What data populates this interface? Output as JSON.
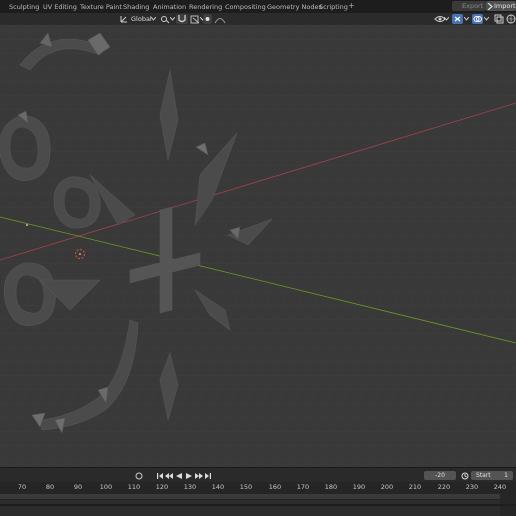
{
  "workspace_tabs": [
    "Sculpting",
    "UV Editing",
    "Texture Paint",
    "Shading",
    "Animation",
    "Rendering",
    "Compositing",
    "Geometry Nodes",
    "Scripting"
  ],
  "add_tab": "+",
  "export_label": "Export",
  "import_label": "Import",
  "header": {
    "orientation_label": "Global"
  },
  "timeline": {
    "current_frame": "-20",
    "start_label": "Start",
    "start_value": "1",
    "ruler_ticks": [
      "70",
      "80",
      "90",
      "100",
      "110",
      "120",
      "130",
      "140",
      "150",
      "160",
      "170",
      "180",
      "190",
      "200",
      "210",
      "220",
      "230",
      "240"
    ]
  },
  "colors": {
    "x_axis": "#a3424f",
    "y_axis": "#6f9a24",
    "background": "#393939",
    "accent": "#4772b3"
  }
}
